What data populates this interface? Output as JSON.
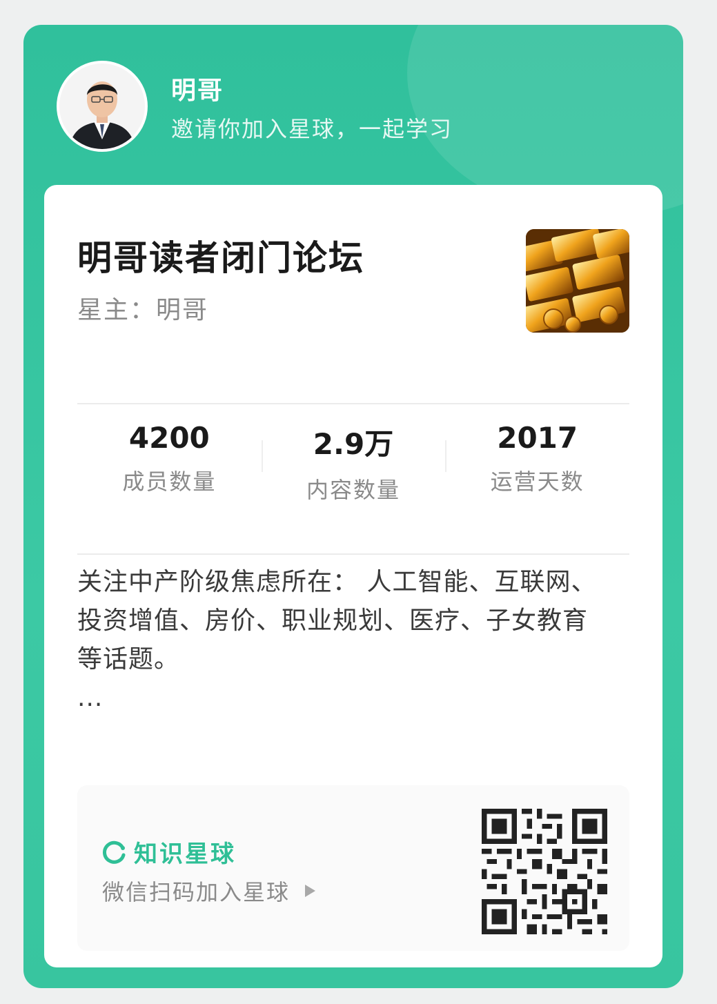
{
  "header": {
    "name": "明哥",
    "subtitle": "邀请你加入星球，一起学习"
  },
  "group": {
    "title": "明哥读者闭门论坛",
    "owner": "星主：明哥",
    "cover_icon": "gold-bars-image"
  },
  "stats": [
    {
      "value": "4200",
      "label": "成员数量"
    },
    {
      "value": "2.9万",
      "label": "内容数量"
    },
    {
      "value": "2017",
      "label": "运营天数"
    }
  ],
  "description": {
    "lines": [
      "关注中产阶级焦虑所在： 人工智能、互联网、",
      "投资增值、房价、职业规划、医疗、子女教育",
      "等话题。",
      "..."
    ]
  },
  "footer": {
    "brand": "知识星球",
    "scan_text": "微信扫码加入星球",
    "qr_icon": "qr-code-icon"
  },
  "colors": {
    "accent": "#38c59f",
    "brand": "#2fbf96"
  }
}
